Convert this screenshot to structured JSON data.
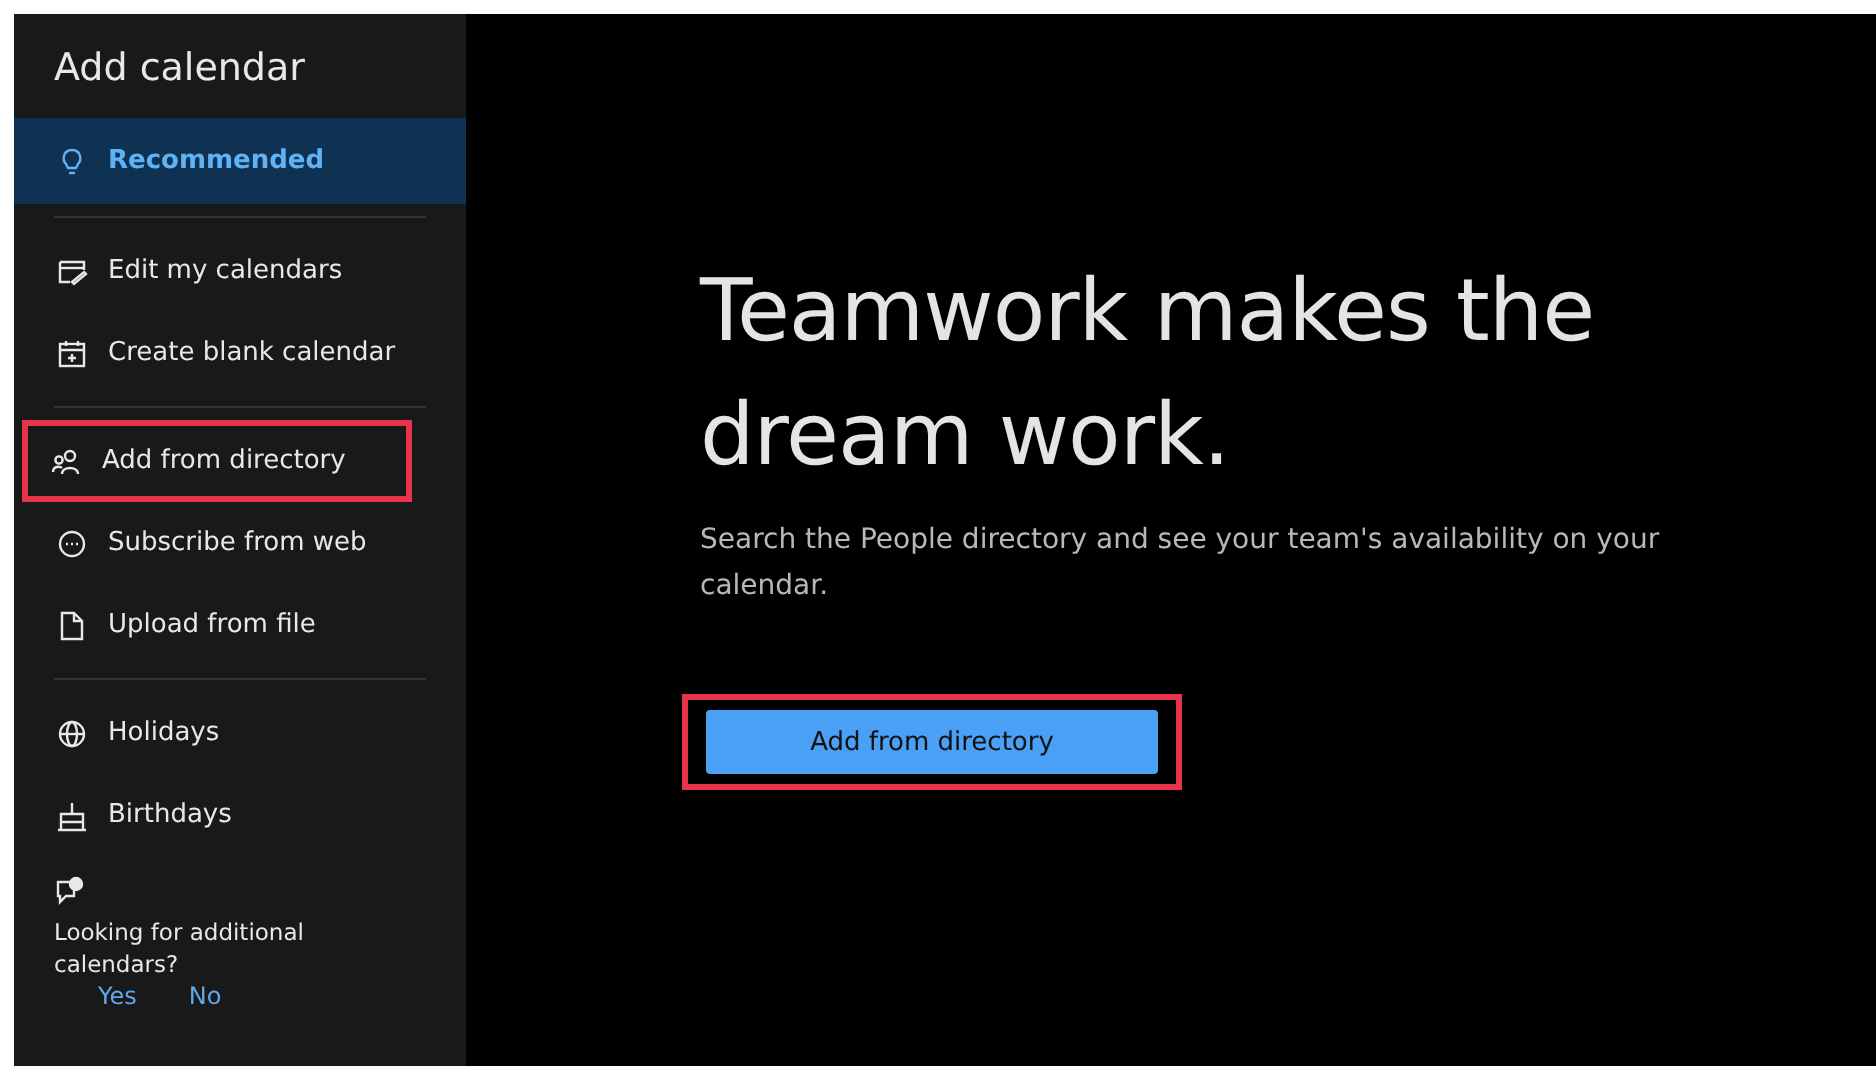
{
  "sidebar": {
    "title": "Add calendar",
    "groups": [
      [
        {
          "label": "Recommended",
          "selected": true,
          "highlighted": false
        }
      ],
      [
        {
          "label": "Edit my calendars",
          "selected": false,
          "highlighted": false
        },
        {
          "label": "Create blank calendar",
          "selected": false,
          "highlighted": false
        }
      ],
      [
        {
          "label": "Add from directory",
          "selected": false,
          "highlighted": true
        },
        {
          "label": "Subscribe from web",
          "selected": false,
          "highlighted": false
        },
        {
          "label": "Upload from file",
          "selected": false,
          "highlighted": false
        }
      ],
      [
        {
          "label": "Holidays",
          "selected": false,
          "highlighted": false
        },
        {
          "label": "Birthdays",
          "selected": false,
          "highlighted": false
        }
      ]
    ],
    "feedback": {
      "question": "Looking for additional calendars?",
      "yes": "Yes",
      "no": "No"
    }
  },
  "main": {
    "headline": "Teamwork makes the dream work.",
    "description": "Search the People directory and see your team's availability on your calendar.",
    "button": {
      "label": "Add from directory",
      "highlighted": true
    }
  }
}
